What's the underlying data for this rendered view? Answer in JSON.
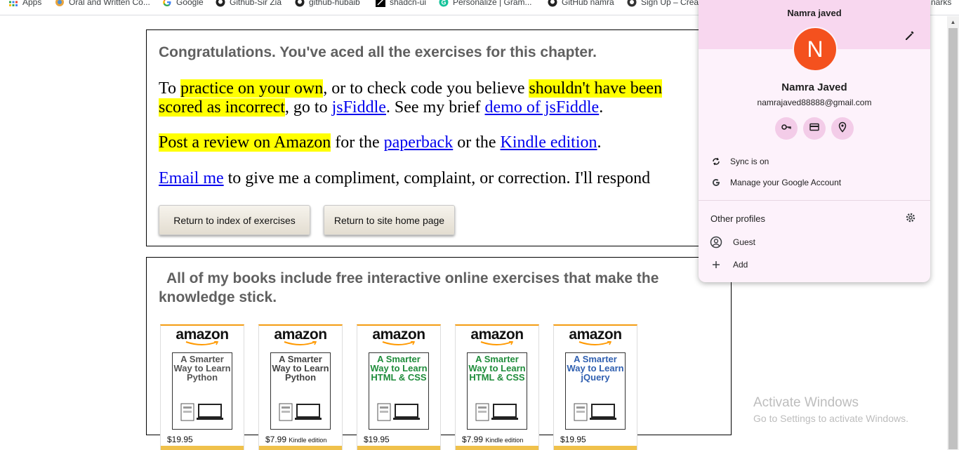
{
  "bookmarks": [
    {
      "label": "Apps",
      "icon": "apps-grid-icon"
    },
    {
      "label": "Oral and Written Co...",
      "icon": "bookmark-icon"
    },
    {
      "label": "Google",
      "icon": "google-icon"
    },
    {
      "label": "Github-Sir Zia",
      "icon": "github-icon"
    },
    {
      "label": "github-hubaib",
      "icon": "github-icon"
    },
    {
      "label": "shadcn-ui",
      "icon": "shadcn-icon"
    },
    {
      "label": "Personalize | Gram...",
      "icon": "grammarly-icon"
    },
    {
      "label": "GitHub namra",
      "icon": "github-icon"
    },
    {
      "label": "Sign Up – Creat",
      "icon": "globe-icon"
    },
    {
      "label": "narks",
      "icon": ""
    }
  ],
  "exercise": {
    "congrats": "Congratulations. You've aced all the exercises for this chapter.",
    "p1": {
      "a": "To ",
      "hl1": "practice on your own",
      "b": ", or to check code you believe ",
      "hl2a": "shouldn't have been",
      "hl2b": "scored as incorrect",
      "c": ", go to ",
      "link1": "jsFiddle",
      "d": ". See my brief ",
      "link2": "demo of jsFiddle",
      "e": "."
    },
    "p2": {
      "hl": "Post a review on Amazon",
      "a": " for the ",
      "link1": "paperback",
      "b": " or the ",
      "link2": "Kindle edition",
      "c": "."
    },
    "p3": {
      "link": "Email me",
      "a": " to give me a compliment, complaint, or correction. I'll respond"
    },
    "buttons": {
      "index": "Return to index of exercises",
      "home": "Return to site home page"
    }
  },
  "books_section": {
    "heading_line1": "All of my books include free interactive online exercises that make the",
    "heading_line2": "knowledge stick.",
    "books": [
      {
        "brand": "amazon",
        "title": "A Smarter Way to Learn Python",
        "title_color": "#555555",
        "price": "$19.95",
        "edition": ""
      },
      {
        "brand": "amazon",
        "title": "A Smarter Way to Learn Python",
        "title_color": "#444444",
        "price": "$7.99",
        "edition": "Kindle edition"
      },
      {
        "brand": "amazon",
        "title": "A Smarter Way to Learn HTML & CSS",
        "title_color": "#1e8c3a",
        "price": "$19.95",
        "edition": ""
      },
      {
        "brand": "amazon",
        "title": "A Smarter Way to Learn HTML & CSS",
        "title_color": "#1e8c3a",
        "price": "$7.99",
        "edition": "Kindle edition"
      },
      {
        "brand": "amazon",
        "title": "A Smarter Way to Learn jQuery",
        "title_color": "#2f5fb0",
        "price": "$19.95",
        "edition": ""
      }
    ]
  },
  "profile": {
    "name_top": "Namra javed",
    "avatar_letter": "N",
    "avatar_color": "#f4511e",
    "name": "Namra Javed",
    "email": "namrajaved88888@gmail.com",
    "sync": "Sync is on",
    "manage": "Manage your Google Account",
    "other_profiles": "Other profiles",
    "guest": "Guest",
    "add": "Add"
  },
  "windows": {
    "line1": "Activate Windows",
    "line2": "Go to Settings to activate Windows."
  },
  "colors": {
    "highlight": "#ffff00",
    "link": "#0000ee",
    "popup_header": "#f8d7ef",
    "popup_bg": "#fdf2fb"
  }
}
